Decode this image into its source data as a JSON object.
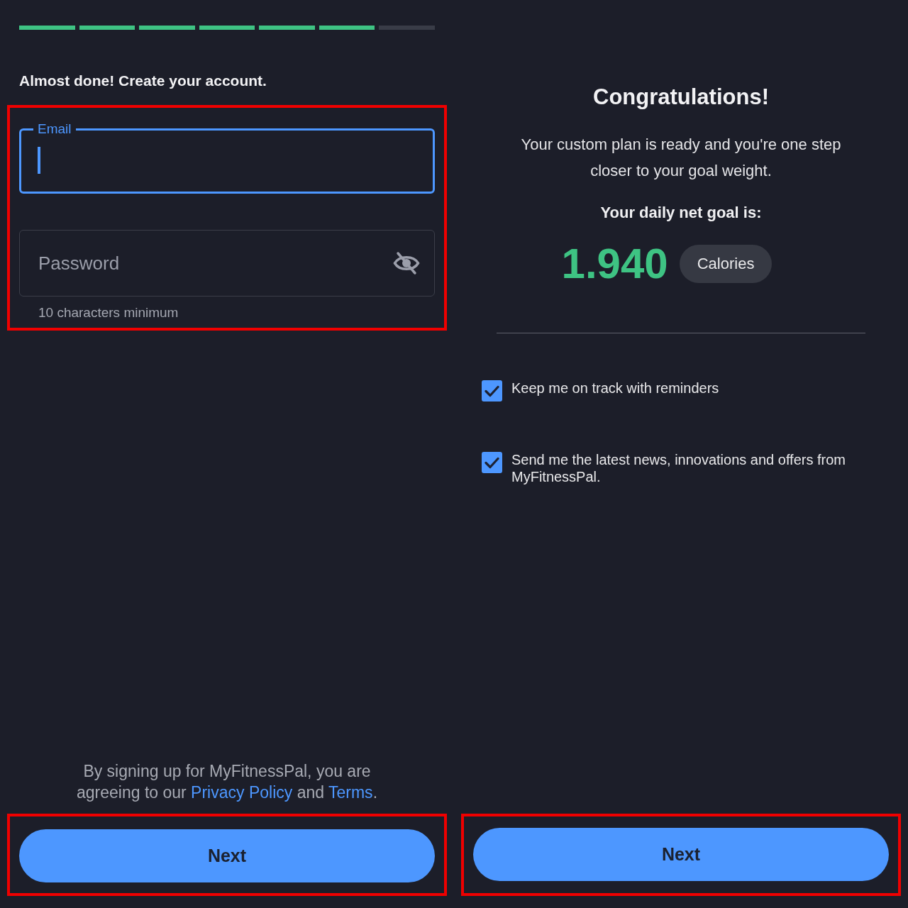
{
  "progress": {
    "steps": [
      {
        "completed": true
      },
      {
        "completed": true
      },
      {
        "completed": true
      },
      {
        "completed": true
      },
      {
        "completed": true
      },
      {
        "completed": true
      },
      {
        "completed": false
      }
    ]
  },
  "signup": {
    "heading": "Almost done! Create your account.",
    "highlighted": true,
    "email": {
      "label": "Email",
      "focused": true
    },
    "password": {
      "placeholder": "Password",
      "hidden": true,
      "hint": "10 characters minimum"
    }
  },
  "legal": {
    "parts": [
      {
        "kind": "text",
        "text": "By signing up for MyFitnessPal, you are agreeing to our "
      },
      {
        "kind": "link",
        "text": "Privacy Policy"
      },
      {
        "kind": "text",
        "text": " and "
      },
      {
        "kind": "link",
        "text": "Terms"
      },
      {
        "kind": "text",
        "text": "."
      }
    ]
  },
  "left_button": {
    "label": "Next",
    "highlighted": true
  },
  "summary": {
    "title": "Congratulations!",
    "message": "Your custom plan is ready and you're one step closer to your goal weight.",
    "goal_label": "Your daily net goal is:",
    "goal_value": "1.940",
    "goal_unit": "Calories"
  },
  "options": [
    {
      "label": "Keep me on track with reminders",
      "checked": true
    },
    {
      "label": "Send me the latest news, innovations and offers from MyFitnessPal.",
      "checked": true
    }
  ],
  "right_button": {
    "label": "Next",
    "highlighted": true
  }
}
